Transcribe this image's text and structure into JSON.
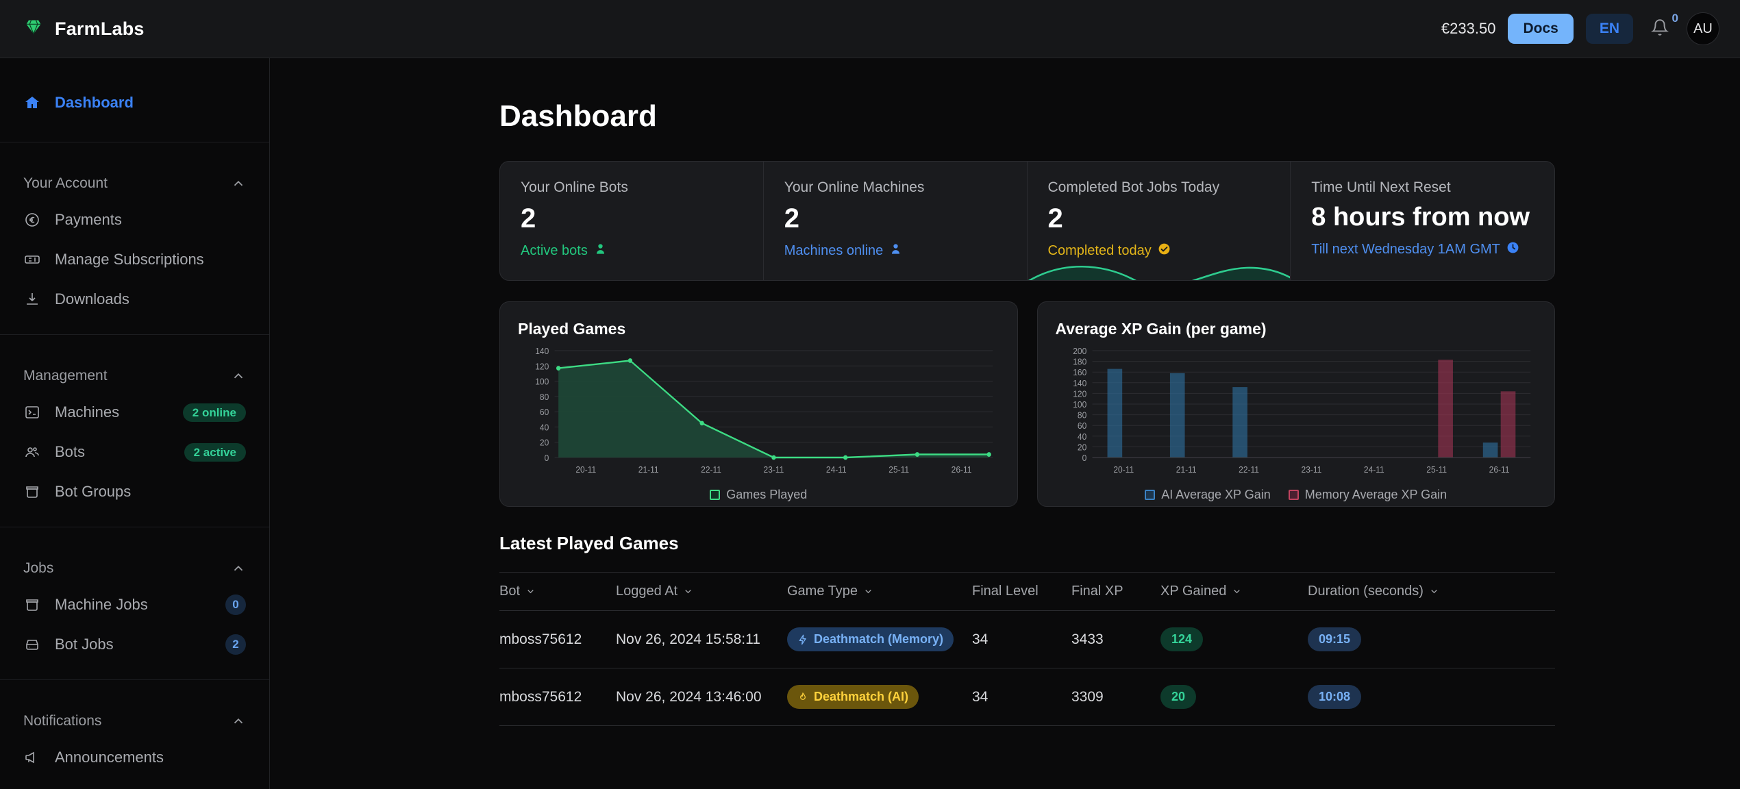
{
  "header": {
    "brand": "FarmLabs",
    "logo_icon": "diamond-icon",
    "balance": "€233.50",
    "docs_label": "Docs",
    "lang_label": "EN",
    "bell_icon": "bell-icon",
    "bell_badge": "0",
    "avatar_initials": "AU"
  },
  "sidebar": {
    "dashboard": {
      "label": "Dashboard",
      "icon": "home-icon"
    },
    "sections": [
      {
        "title": "Your Account",
        "items": [
          {
            "label": "Payments",
            "icon": "euro-circle-icon",
            "badge": null
          },
          {
            "label": "Manage Subscriptions",
            "icon": "ticket-icon",
            "badge": null
          },
          {
            "label": "Downloads",
            "icon": "download-icon",
            "badge": null
          }
        ]
      },
      {
        "title": "Management",
        "items": [
          {
            "label": "Machines",
            "icon": "terminal-icon",
            "badge": "2 online",
            "badge_type": "green"
          },
          {
            "label": "Bots",
            "icon": "users-icon",
            "badge": "2 active",
            "badge_type": "green"
          },
          {
            "label": "Bot Groups",
            "icon": "box-icon",
            "badge": null
          }
        ]
      },
      {
        "title": "Jobs",
        "items": [
          {
            "label": "Machine Jobs",
            "icon": "box-icon",
            "badge": "0",
            "badge_type": "count"
          },
          {
            "label": "Bot Jobs",
            "icon": "server-icon",
            "badge": "2",
            "badge_type": "count"
          }
        ]
      },
      {
        "title": "Notifications",
        "items": [
          {
            "label": "Announcements",
            "icon": "megaphone-icon",
            "badge": null
          }
        ]
      }
    ]
  },
  "page": {
    "title": "Dashboard"
  },
  "stats": [
    {
      "label": "Your Online Bots",
      "value": "2",
      "sub": "Active bots",
      "sub_icon": "person-icon",
      "sub_color": "#22c77e"
    },
    {
      "label": "Your Online Machines",
      "value": "2",
      "sub": "Machines online",
      "sub_icon": "person-icon",
      "sub_color": "#4f8ff0"
    },
    {
      "label": "Completed Bot Jobs Today",
      "value": "2",
      "sub": "Completed today",
      "sub_icon": "check-circle-icon",
      "sub_color": "#e3b519"
    },
    {
      "label": "Time Until Next Reset",
      "value": "8 hours from now",
      "sub": "Till next Wednesday 1AM GMT",
      "sub_icon": "clock-icon",
      "sub_color": "#4f8ff0"
    }
  ],
  "chart_data": [
    {
      "type": "area",
      "title": "Played Games",
      "categories": [
        "20-11",
        "21-11",
        "22-11",
        "23-11",
        "24-11",
        "25-11",
        "26-11"
      ],
      "series": [
        {
          "name": "Games Played",
          "values": [
            117,
            127,
            45,
            0,
            0,
            4,
            4
          ],
          "color": "#3ddc84"
        }
      ],
      "ylim": [
        0,
        140
      ],
      "yticks": [
        0,
        20,
        40,
        60,
        80,
        100,
        120,
        140
      ],
      "xlabel": "",
      "ylabel": "",
      "grid": true,
      "legend_position": "bottom"
    },
    {
      "type": "bar",
      "title": "Average XP Gain (per game)",
      "categories": [
        "20-11",
        "21-11",
        "22-11",
        "23-11",
        "24-11",
        "25-11",
        "26-11"
      ],
      "series": [
        {
          "name": "AI Average XP Gain",
          "values": [
            165,
            157,
            131,
            0,
            0,
            0,
            27
          ],
          "color": "#2e6f9e"
        },
        {
          "name": "Memory Average XP Gain",
          "values": [
            0,
            0,
            0,
            0,
            0,
            182,
            123
          ],
          "color": "#9e3452"
        }
      ],
      "ylim": [
        0,
        200
      ],
      "yticks": [
        0,
        20,
        40,
        60,
        80,
        100,
        120,
        140,
        160,
        180,
        200
      ],
      "xlabel": "",
      "ylabel": "",
      "grid": true,
      "legend_position": "bottom"
    }
  ],
  "table": {
    "title": "Latest Played Games",
    "columns": [
      {
        "label": "Bot",
        "sortable": true
      },
      {
        "label": "Logged At",
        "sortable": true
      },
      {
        "label": "Game Type",
        "sortable": true
      },
      {
        "label": "Final Level",
        "sortable": false
      },
      {
        "label": "Final XP",
        "sortable": false
      },
      {
        "label": "XP Gained",
        "sortable": true
      },
      {
        "label": "Duration (seconds)",
        "sortable": true
      }
    ],
    "rows": [
      {
        "bot": "mboss75612",
        "logged_at": "Nov 26, 2024 15:58:11",
        "game_type": "Deathmatch (Memory)",
        "game_type_icon": "lightning-icon",
        "game_type_style": "blue",
        "final_level": "34",
        "final_xp": "3433",
        "xp_gained": "124",
        "duration": "09:15"
      },
      {
        "bot": "mboss75612",
        "logged_at": "Nov 26, 2024 13:46:00",
        "game_type": "Deathmatch (AI)",
        "game_type_icon": "flame-icon",
        "game_type_style": "gold",
        "final_level": "34",
        "final_xp": "3309",
        "xp_gained": "20",
        "duration": "10:08"
      }
    ]
  }
}
